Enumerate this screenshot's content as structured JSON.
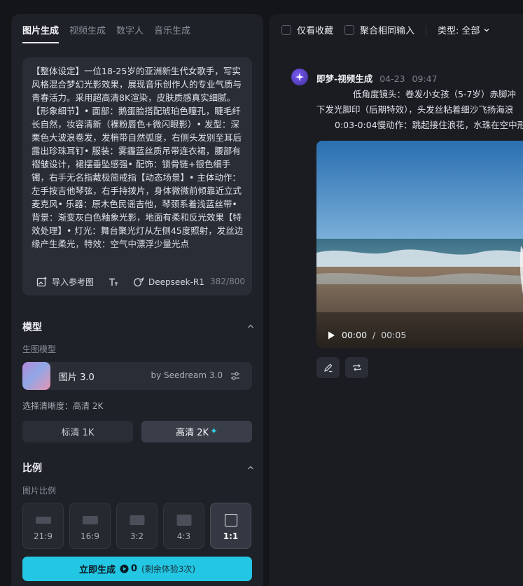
{
  "tabs": [
    {
      "label": "图片生成",
      "active": true
    },
    {
      "label": "视频生成",
      "active": false
    },
    {
      "label": "数字人",
      "active": false
    },
    {
      "label": "音乐生成",
      "active": false
    }
  ],
  "prompt": {
    "text": "【整体设定】一位18-25岁的亚洲新生代女歌手，写实风格混合梦幻光影效果，展现音乐创作人的专业气质与青春活力。采用超高清8K渲染，皮肤质感真实细腻。【形象细节】• 面部：鹅蛋脸搭配琥珀色瞳孔，睫毛纤长自然，妆容清新（裸粉唇色+微闪眼影）• 发型：深栗色大波浪卷发，发梢带自然弧度，右侧头发别至耳后露出珍珠耳钉• 服装：雾霾蓝丝质吊带连衣裙，腰部有褶皱设计，裙摆垂坠感强• 配饰：锁骨链+银色细手镯，右手无名指戴极简戒指【动态场景】• 主体动作：左手按吉他琴弦，右手持拨片，身体微微前倾靠近立式麦克风• 乐器：原木色民谣吉他，琴颈系着浅蓝丝带• 背景：渐变灰白色釉象光影，地面有柔和反光效果【特效处理】• 灯光：舞台聚光灯从左侧45度照射，发丝边缘产生柔光，特效：空气中漂浮少量光点",
    "import_ref": "导入参考图",
    "model_tool": "Deepseek-R1",
    "counter": "382/800"
  },
  "model_section": {
    "title": "模型",
    "sub_label": "生图模型",
    "model_name": "图片 3.0",
    "model_by": "by Seedream 3.0"
  },
  "resolution": {
    "label": "选择清晰度：高清 2K",
    "options": [
      "标清 1K",
      "高清 2K"
    ],
    "sparkle": "✦"
  },
  "ratio_section": {
    "title": "比例",
    "sub_label": "图片比例",
    "options": [
      "21:9",
      "16:9",
      "3:2",
      "4:3",
      "1:1"
    ]
  },
  "generate": {
    "label": "立即生成",
    "cost": "0",
    "note": "(剩余体验3次)"
  },
  "filters": {
    "favorites": "仅看收藏",
    "merge": "聚合相同输入",
    "type": "类型: 全部"
  },
  "record": {
    "title": "即梦-视频生成",
    "date": "04-23",
    "time": "09:47",
    "prompt_lines": [
      "低角度镜头：卷发小女孩（5-7岁）赤脚冲",
      "下发光脚印（后期特效），头发丝粘着细沙飞扬海浪",
      "0:03-0:04慢动作：跳起接住浪花，水珠在空中形"
    ],
    "current_time": "00:00",
    "separator": "/",
    "duration": "00:05"
  },
  "colors": {
    "accent": "#23c6e3",
    "panel": "#1f2128",
    "card": "#2a2d35"
  }
}
